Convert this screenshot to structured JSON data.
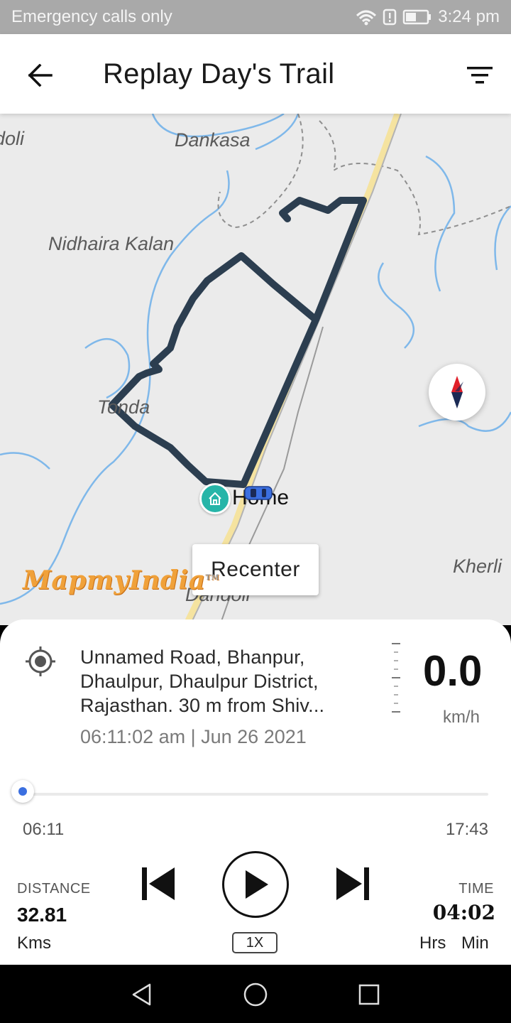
{
  "status_bar": {
    "carrier": "Emergency calls only",
    "time": "3:24 pm"
  },
  "app_bar": {
    "title": "Replay Day's Trail"
  },
  "map": {
    "places": [
      "doli",
      "Dankasa",
      "Nidhaira Kalan",
      "Tonda",
      "Kherli",
      "Dandoli"
    ],
    "home_label": "Home",
    "recenter_label": "Recenter",
    "logo_text": "MapmyIndia",
    "route_color": "#2c3e50",
    "home_pin_color": "#26b5a8"
  },
  "trip": {
    "address": "Unnamed Road, Bhanpur, Dhaulpur, Dhaulpur District, Rajasthan. 30 m from Shiv...",
    "datetime": "06:11:02 am | Jun 26 2021",
    "speed": "0.0",
    "speed_unit": "km/h"
  },
  "timeline": {
    "start": "06:11",
    "end": "17:43",
    "progress": 0
  },
  "stats": {
    "distance_label": "DISTANCE",
    "distance_value": "32.81",
    "distance_unit": "Kms",
    "time_label": "TIME",
    "time_value": "04:02",
    "time_unit_hours": "Hrs",
    "time_unit_minutes": "Min"
  },
  "controls": {
    "playback_speed": "1X"
  },
  "accent_color": "#3b6fe0"
}
